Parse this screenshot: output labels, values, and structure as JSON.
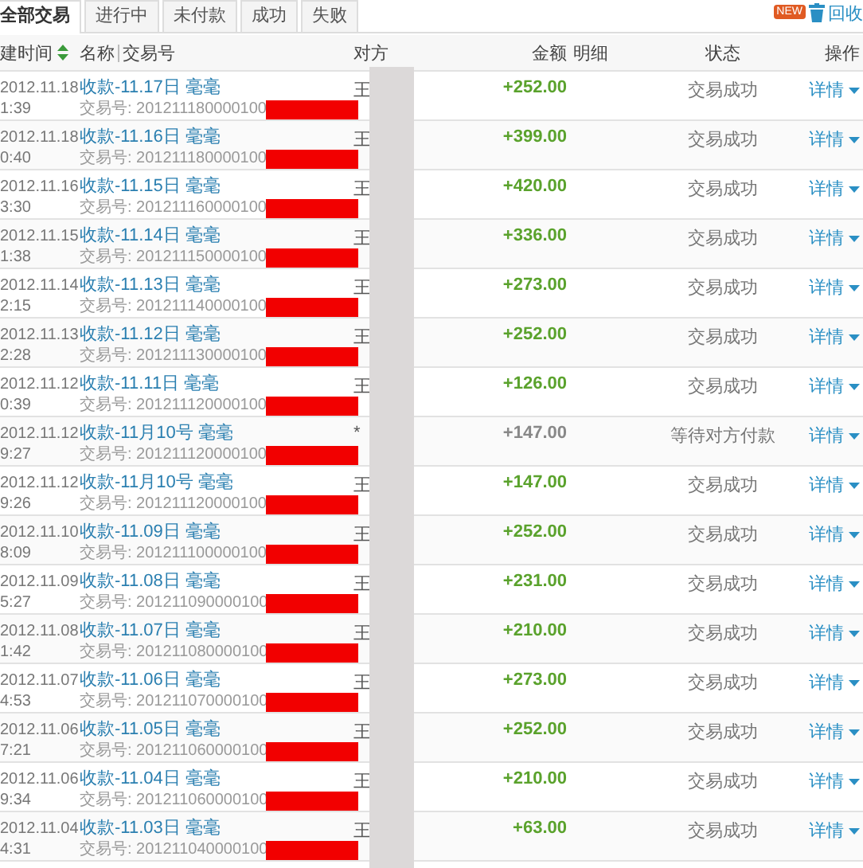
{
  "tabs": [
    {
      "label": "全部交易",
      "selected": true
    },
    {
      "label": "进行中",
      "selected": false
    },
    {
      "label": "未付款",
      "selected": false
    },
    {
      "label": "成功",
      "selected": false
    },
    {
      "label": "失败",
      "selected": false
    }
  ],
  "toolbar": {
    "badge": "NEW",
    "link": "回收"
  },
  "table": {
    "columns": [
      "建时间",
      "名称",
      "交易号",
      "对方",
      "金额",
      "明细",
      "状态",
      "操作"
    ],
    "rows": [
      {
        "date": "2012.11.18",
        "time": "1:39",
        "name": "收款-11.17日 毫毫",
        "trade_no": "交易号: 201211180000100",
        "party": "王",
        "amount": "+252.00",
        "status": "交易成功",
        "kind": "success",
        "action": "详情"
      },
      {
        "date": "2012.11.18",
        "time": "0:40",
        "name": "收款-11.16日 毫毫",
        "trade_no": "交易号: 201211180000100",
        "party": "王",
        "amount": "+399.00",
        "status": "交易成功",
        "kind": "success",
        "action": "详情"
      },
      {
        "date": "2012.11.16",
        "time": "3:30",
        "name": "收款-11.15日 毫毫",
        "trade_no": "交易号: 201211160000100",
        "party": "王",
        "amount": "+420.00",
        "status": "交易成功",
        "kind": "success",
        "action": "详情"
      },
      {
        "date": "2012.11.15",
        "time": "1:38",
        "name": "收款-11.14日 毫毫",
        "trade_no": "交易号: 201211150000100",
        "party": "王",
        "amount": "+336.00",
        "status": "交易成功",
        "kind": "success",
        "action": "详情"
      },
      {
        "date": "2012.11.14",
        "time": "2:15",
        "name": "收款-11.13日 毫毫",
        "trade_no": "交易号: 201211140000100",
        "party": "王",
        "amount": "+273.00",
        "status": "交易成功",
        "kind": "success",
        "action": "详情"
      },
      {
        "date": "2012.11.13",
        "time": "2:28",
        "name": "收款-11.12日 毫毫",
        "trade_no": "交易号: 201211130000100",
        "party": "王",
        "amount": "+252.00",
        "status": "交易成功",
        "kind": "success",
        "action": "详情"
      },
      {
        "date": "2012.11.12",
        "time": "0:39",
        "name": "收款-11.11日 毫毫",
        "trade_no": "交易号: 201211120000100",
        "party": "王",
        "amount": "+126.00",
        "status": "交易成功",
        "kind": "success",
        "action": "详情"
      },
      {
        "date": "2012.11.12",
        "time": "9:27",
        "name": "收款-11月10号 毫毫",
        "trade_no": "交易号: 201211120000100",
        "party": "*",
        "amount": "+147.00",
        "status": "等待对方付款",
        "kind": "pending",
        "action": "详情"
      },
      {
        "date": "2012.11.12",
        "time": "9:26",
        "name": "收款-11月10号 毫毫",
        "trade_no": "交易号: 201211120000100",
        "party": "王",
        "amount": "+147.00",
        "status": "交易成功",
        "kind": "success",
        "action": "详情"
      },
      {
        "date": "2012.11.10",
        "time": "8:09",
        "name": "收款-11.09日 毫毫",
        "trade_no": "交易号: 201211100000100",
        "party": "王",
        "amount": "+252.00",
        "status": "交易成功",
        "kind": "success",
        "action": "详情"
      },
      {
        "date": "2012.11.09",
        "time": "5:27",
        "name": "收款-11.08日 毫毫",
        "trade_no": "交易号: 201211090000100",
        "party": "王",
        "amount": "+231.00",
        "status": "交易成功",
        "kind": "success",
        "action": "详情"
      },
      {
        "date": "2012.11.08",
        "time": "1:42",
        "name": "收款-11.07日 毫毫",
        "trade_no": "交易号: 201211080000100",
        "party": "王",
        "amount": "+210.00",
        "status": "交易成功",
        "kind": "success",
        "action": "详情"
      },
      {
        "date": "2012.11.07",
        "time": "4:53",
        "name": "收款-11.06日 毫毫",
        "trade_no": "交易号: 201211070000100",
        "party": "王",
        "amount": "+273.00",
        "status": "交易成功",
        "kind": "success",
        "action": "详情"
      },
      {
        "date": "2012.11.06",
        "time": "7:21",
        "name": "收款-11.05日 毫毫",
        "trade_no": "交易号: 201211060000100",
        "party": "王",
        "amount": "+252.00",
        "status": "交易成功",
        "kind": "success",
        "action": "详情"
      },
      {
        "date": "2012.11.06",
        "time": "9:34",
        "name": "收款-11.04日 毫毫",
        "trade_no": "交易号: 201211060000100",
        "party": "王",
        "amount": "+210.00",
        "status": "交易成功",
        "kind": "success",
        "action": "详情"
      },
      {
        "date": "2012.11.04",
        "time": "4:31",
        "name": "收款-11.03日 毫毫",
        "trade_no": "交易号: 201211040000100",
        "party": "王",
        "amount": "+63.00",
        "status": "交易成功",
        "kind": "success",
        "action": "详情"
      }
    ]
  }
}
